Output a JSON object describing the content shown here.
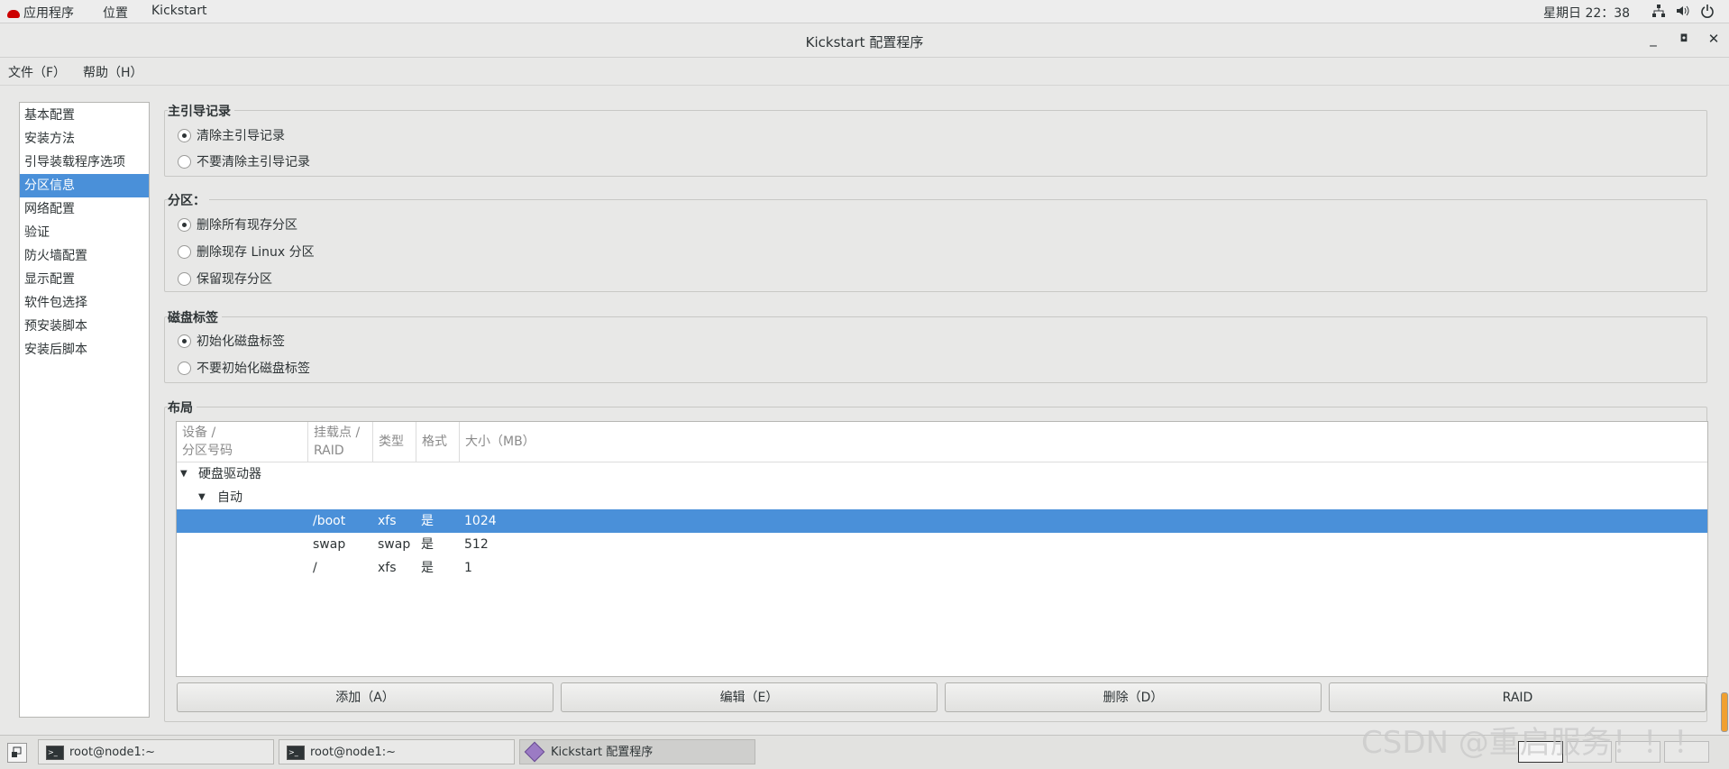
{
  "topbar": {
    "applications": "应用程序",
    "places": "位置",
    "app": "Kickstart",
    "clock": "星期日 22：38"
  },
  "window": {
    "title": "Kickstart 配置程序"
  },
  "menu": {
    "file": "文件（F）",
    "help": "帮助（H）"
  },
  "sidebar": {
    "items": [
      "基本配置",
      "安装方法",
      "引导装载程序选项",
      "分区信息",
      "网络配置",
      "验证",
      "防火墙配置",
      "显示配置",
      "软件包选择",
      "预安装脚本",
      "安装后脚本"
    ],
    "active_index": 3
  },
  "mbr": {
    "title": "主引导记录",
    "options": [
      "清除主引导记录",
      "不要清除主引导记录"
    ],
    "selected": 0
  },
  "partitions": {
    "title": "分区：",
    "options": [
      "删除所有现存分区",
      "删除现存 Linux 分区",
      "保留现存分区"
    ],
    "selected": 0
  },
  "disklabel": {
    "title": "磁盘标签",
    "options": [
      "初始化磁盘标签",
      "不要初始化磁盘标签"
    ],
    "selected": 0
  },
  "layout": {
    "title": "布局",
    "columns": [
      "设备 / 分区号码",
      "挂载点 / RAID",
      "类型",
      "格式",
      "大小（MB）"
    ],
    "col1_line1": "设备 /",
    "col1_line2": "分区号码",
    "col2_line1": "挂载点 /",
    "col2_line2": "RAID",
    "tree_root": "硬盘驱动器",
    "tree_child": "自动",
    "rows": [
      {
        "mount": "/boot",
        "type": "xfs",
        "format": "是",
        "size": "1024"
      },
      {
        "mount": "swap",
        "type": "swap",
        "format": "是",
        "size": "512"
      },
      {
        "mount": "/",
        "type": "xfs",
        "format": "是",
        "size": "1"
      }
    ],
    "selected_row": 0
  },
  "buttons": {
    "add": "添加（A）",
    "edit": "编辑（E）",
    "delete": "删除（D）",
    "raid": "RAID"
  },
  "taskbar": {
    "tasks": [
      "root@node1:~",
      "root@node1:~",
      "Kickstart 配置程序"
    ]
  },
  "watermark": "CSDN @重启服务！！！",
  "colors": {
    "accent": "#4a90d9"
  }
}
